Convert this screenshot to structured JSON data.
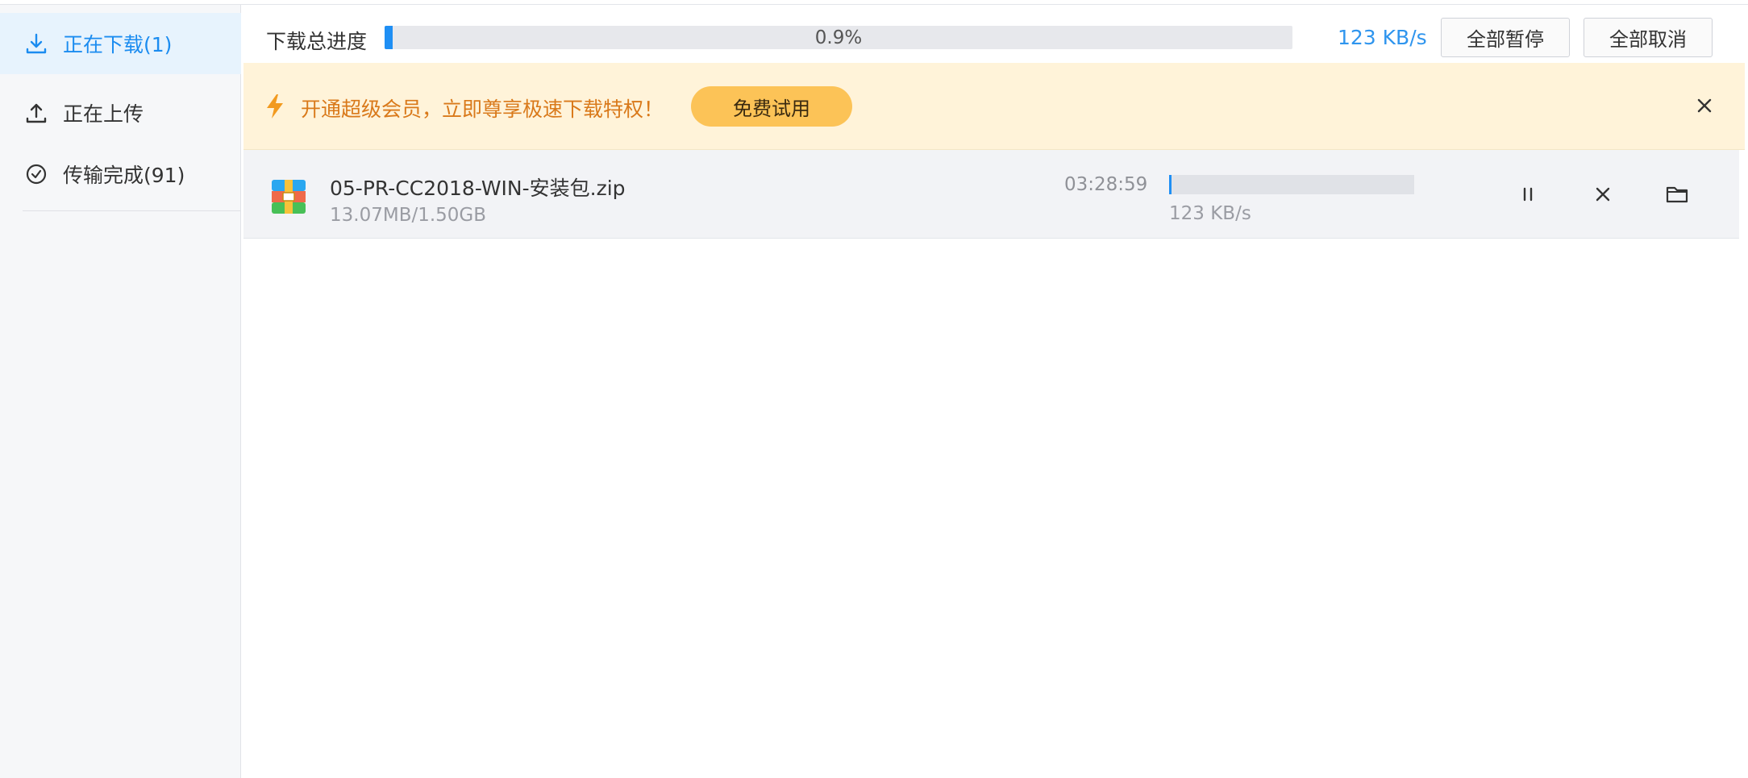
{
  "sidebar": {
    "items": [
      {
        "label": "正在下载(1)",
        "icon": "download-icon",
        "active": true
      },
      {
        "label": "正在上传",
        "icon": "upload-icon",
        "active": false
      },
      {
        "label": "传输完成(91)",
        "icon": "check-circle-icon",
        "active": false
      }
    ]
  },
  "total": {
    "label": "下载总进度",
    "percent_text": "0.9%",
    "progress": 0.009,
    "speed": "123 KB/s",
    "pause_all": "全部暂停",
    "cancel_all": "全部取消"
  },
  "banner": {
    "message": "开通超级会员，立即尊享极速下载特权！",
    "trial_button": "免费试用",
    "icon": "lightning-icon"
  },
  "downloads": [
    {
      "name": "05-PR-CC2018-WIN-安装包.zip",
      "size": "13.07MB/1.50GB",
      "remaining": "03:28:59",
      "speed": "123 KB/s",
      "progress": 0.009,
      "icon": "zip-archive-icon"
    }
  ],
  "colors": {
    "accent": "#1f8ff4",
    "banner_bg": "#fff3d9",
    "banner_text": "#d9791a",
    "trial_button": "#fcc357"
  }
}
